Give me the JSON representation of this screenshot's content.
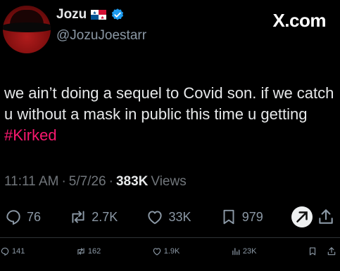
{
  "author": {
    "name": "Jozu",
    "handle": "@JozuJoestarr",
    "flag_icon": "panama-flag-icon",
    "verified_icon": "verified-badge-icon"
  },
  "source_label": "X.com",
  "tweet": {
    "text_before": "we ain’t doing a sequel to Covid son. if we catch u without a mask in public this time u getting ",
    "hashtag": "#Kirked"
  },
  "meta": {
    "time": "11:11 AM",
    "sep1": "·",
    "date": "5/7/26",
    "sep2": "·",
    "views_count": "383K",
    "views_label": "Views"
  },
  "actions": {
    "replies": "76",
    "reposts": "2.7K",
    "likes": "33K",
    "bookmarks": "979"
  },
  "secondary_actions": {
    "replies": "141",
    "reposts": "162",
    "likes": "1.9K",
    "views": "23K"
  },
  "colors": {
    "background": "#000000",
    "hashtag": "#f9186f",
    "muted": "#8b98a5",
    "verified": "#1d9bf0"
  }
}
